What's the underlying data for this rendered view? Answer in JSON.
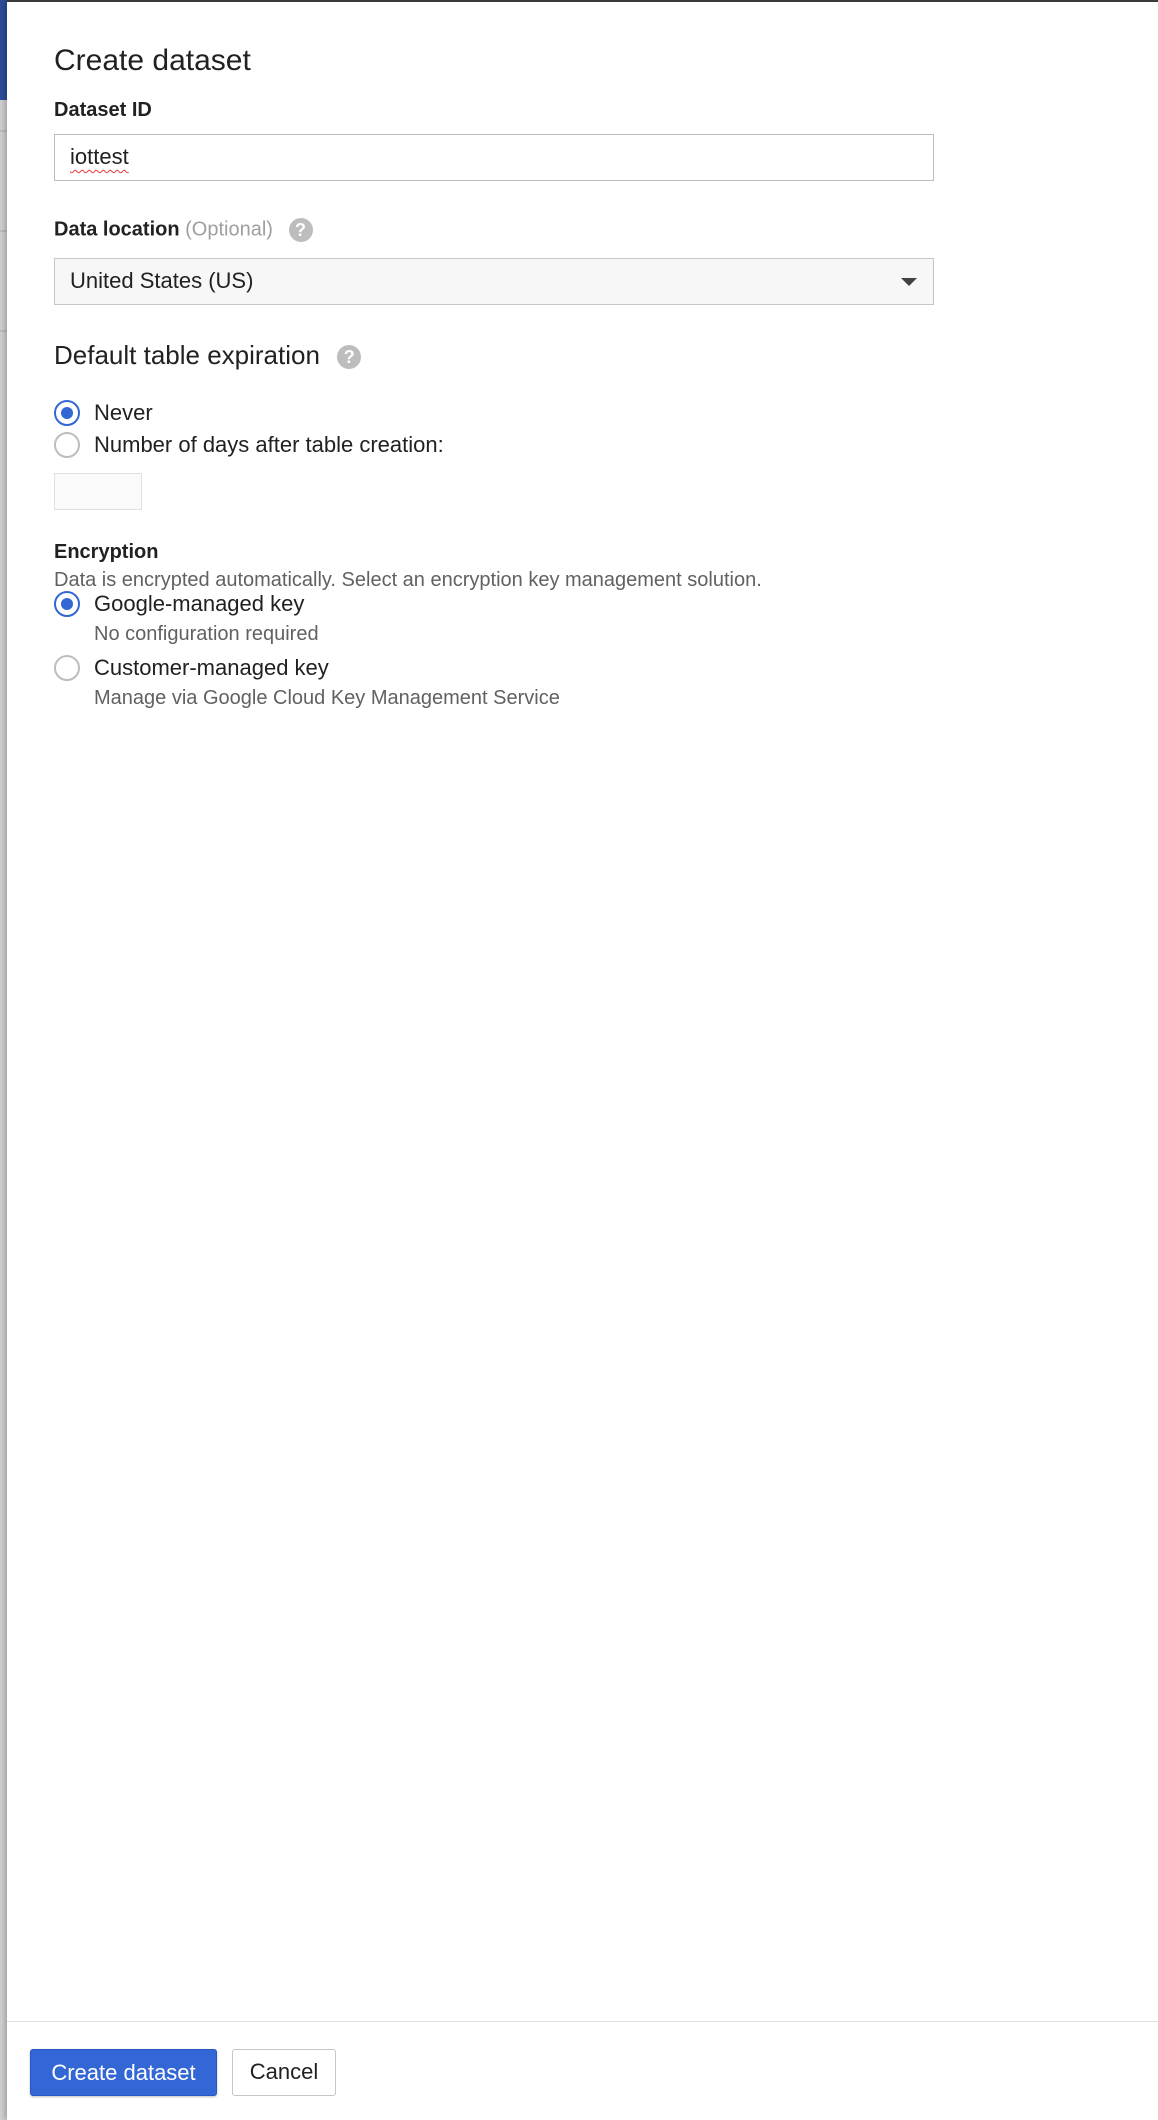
{
  "dialog": {
    "title": "Create dataset"
  },
  "dataset_id": {
    "label": "Dataset ID",
    "value": "iottest"
  },
  "data_location": {
    "label": "Data location",
    "optional": "(Optional)",
    "help_icon": "help-circle-icon",
    "selected": "United States (US)"
  },
  "table_expiration": {
    "heading": "Default table expiration",
    "help_icon": "help-circle-icon",
    "options": [
      {
        "label": "Never",
        "checked": true
      },
      {
        "label": "Number of days after table creation:",
        "checked": false
      }
    ],
    "days_value": ""
  },
  "encryption": {
    "label": "Encryption",
    "description": "Data is encrypted automatically. Select an encryption key management solution.",
    "options": [
      {
        "label": "Google-managed key",
        "sublabel": "No configuration required",
        "checked": true
      },
      {
        "label": "Customer-managed key",
        "sublabel": "Manage via Google Cloud Key Management Service",
        "checked": false
      }
    ]
  },
  "footer": {
    "create_label": "Create dataset",
    "cancel_label": "Cancel"
  },
  "colors": {
    "accent": "#3367d6",
    "background_app": "#2c4d9c"
  }
}
